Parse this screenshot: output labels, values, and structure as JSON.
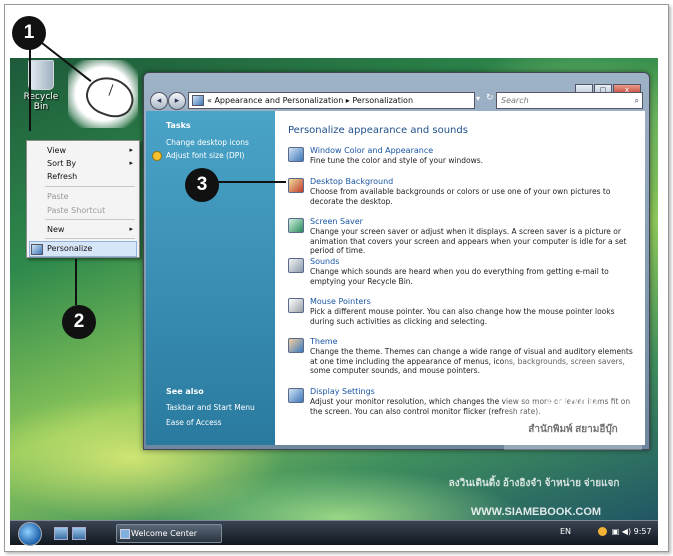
{
  "desktop": {
    "recycle_bin_label": "Recycle Bin"
  },
  "context_menu": {
    "items": [
      {
        "label": "View",
        "has_submenu": true,
        "enabled": true
      },
      {
        "label": "Sort By",
        "has_submenu": true,
        "enabled": true
      },
      {
        "label": "Refresh",
        "has_submenu": false,
        "enabled": true
      },
      {
        "label": "Paste",
        "has_submenu": false,
        "enabled": false
      },
      {
        "label": "Paste Shortcut",
        "has_submenu": false,
        "enabled": false
      },
      {
        "label": "New",
        "has_submenu": true,
        "enabled": true
      },
      {
        "label": "Personalize",
        "has_submenu": false,
        "enabled": true,
        "selected": true
      }
    ],
    "submenu_arrow": "▸"
  },
  "callouts": [
    "1",
    "2",
    "3"
  ],
  "window": {
    "buttons": {
      "minimize": "_",
      "maximize": "□",
      "close": "x"
    },
    "back": "◂",
    "forward": "▸",
    "address": "« Appearance and Personalization ▸ Personalization",
    "search_placeholder": "Search",
    "tasks": {
      "header": "Tasks",
      "links": [
        "Change desktop icons",
        "Adjust font size (DPI)"
      ]
    },
    "see_also": {
      "header": "See also",
      "links": [
        "Taskbar and Start Menu",
        "Ease of Access"
      ]
    },
    "title": "Personalize appearance and sounds",
    "items": [
      {
        "link": "Window Color and Appearance",
        "desc": "Fine tune the color and style of your windows."
      },
      {
        "link": "Desktop Background",
        "desc": "Choose from available backgrounds or colors or use one of your own pictures to decorate the desktop."
      },
      {
        "link": "Screen Saver",
        "desc": "Change your screen saver or adjust when it displays. A screen saver is a picture or animation that covers your screen and appears when your computer is idle for a set period of time."
      },
      {
        "link": "Sounds",
        "desc": "Change which sounds are heard when you do everything from getting e-mail to emptying your Recycle Bin."
      },
      {
        "link": "Mouse Pointers",
        "desc": "Pick a different mouse pointer. You can also change how the mouse pointer looks during such activities as clicking and selecting."
      },
      {
        "link": "Theme",
        "desc": "Change the theme. Themes can change a wide range of visual and auditory elements at one time including the appearance of menus, icons, backgrounds, screen savers, some computer sounds, and mouse pointers."
      },
      {
        "link": "Display Settings",
        "desc": "Adjust your monitor resolution, which changes the view so more or fewer items fit on the screen. You can also control monitor flicker (refresh rate)."
      }
    ]
  },
  "watermark": {
    "line1": "Siam",
    "line2": "eBook",
    "line3": "สำนักพิมพ์ สยามอีบุ๊ก",
    "line4": "ลงวินเดินดิ้ง อ้างอิงจำ จ้าหน่าย จ่ายแจก",
    "url": "WWW.SIAMEBOOK.COM"
  },
  "taskbar": {
    "task_button": "Welcome Center",
    "language": "EN",
    "clock": "9:57"
  }
}
